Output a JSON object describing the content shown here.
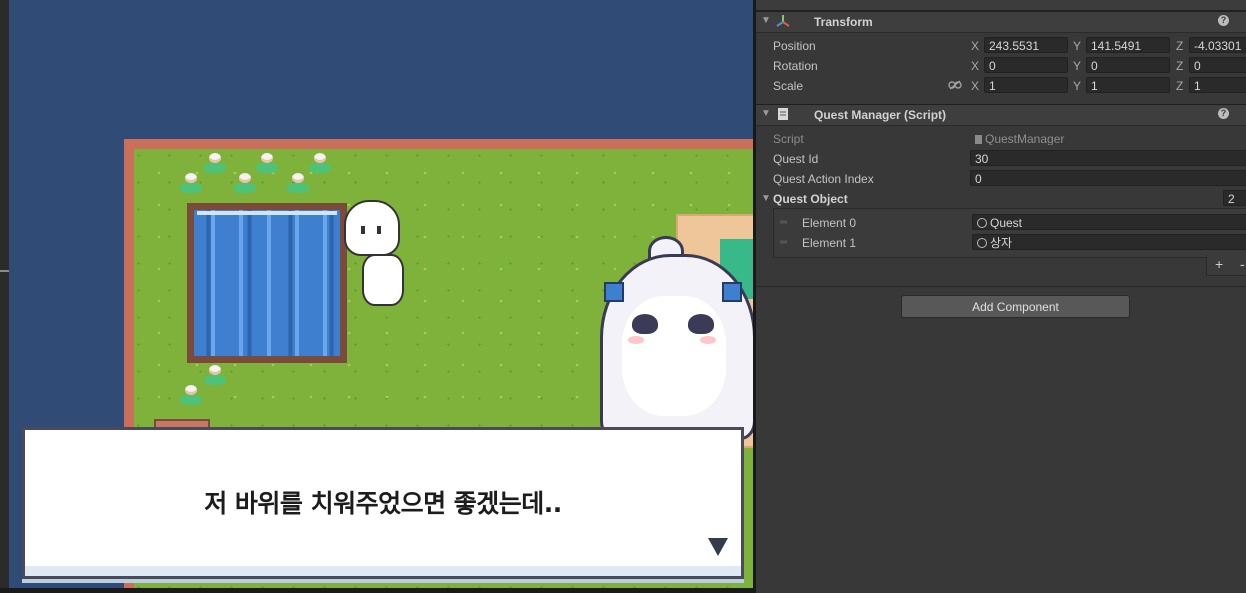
{
  "game": {
    "dialog_text": "저 바위를 치워주었으면 좋겠는데.."
  },
  "inspector": {
    "transform": {
      "title": "Transform",
      "position": {
        "label": "Position",
        "x": "243.5531",
        "y": "141.5491",
        "z": "-4.03301"
      },
      "rotation": {
        "label": "Rotation",
        "x": "0",
        "y": "0",
        "z": "0"
      },
      "scale": {
        "label": "Scale",
        "x": "1",
        "y": "1",
        "z": "1"
      }
    },
    "quest_manager": {
      "title": "Quest Manager (Script)",
      "script_label": "Script",
      "script_value": "QuestManager",
      "quest_id_label": "Quest Id",
      "quest_id_value": "30",
      "quest_action_index_label": "Quest Action Index",
      "quest_action_index_value": "0",
      "quest_object_label": "Quest Object",
      "quest_object_count": "2",
      "elements": [
        {
          "label": "Element 0",
          "value": "Quest"
        },
        {
          "label": "Element 1",
          "value": "상자"
        }
      ],
      "add_label": "+",
      "remove_label": "-"
    },
    "axis_x": "X",
    "axis_y": "Y",
    "axis_z": "Z",
    "help_glyph": "?",
    "add_component_label": "Add Component"
  },
  "colors": {
    "game_background": "#2f4b76",
    "grass": "#7fb23a",
    "inspector_background": "#383838"
  }
}
